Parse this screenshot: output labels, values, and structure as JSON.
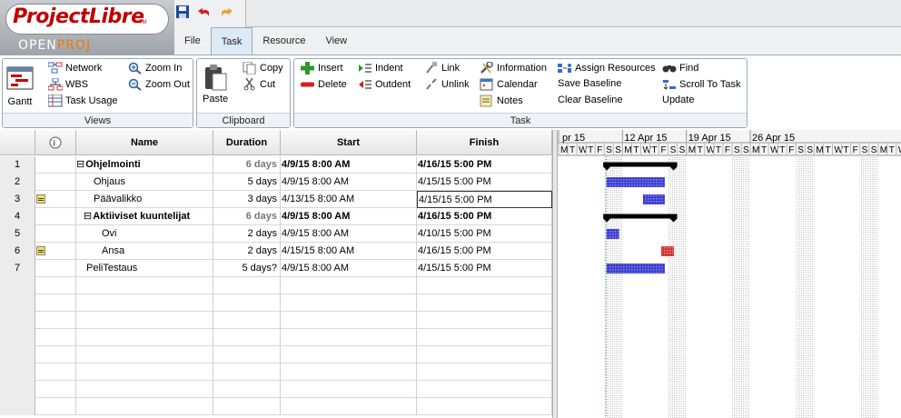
{
  "app": {
    "logo_main": "ProjectLibre",
    "logo_tm": "TM",
    "logo_sub_a": "OPEN",
    "logo_sub_b": "PROJ"
  },
  "quick_access": {
    "icons": [
      "save-icon",
      "undo-icon",
      "redo-icon"
    ]
  },
  "tabs": [
    {
      "label": "File",
      "active": false
    },
    {
      "label": "Task",
      "active": true
    },
    {
      "label": "Resource",
      "active": false
    },
    {
      "label": "View",
      "active": false
    }
  ],
  "ribbon": {
    "views": {
      "label": "Views",
      "gantt": "Gantt",
      "network": "Network",
      "wbs": "WBS",
      "task_usage": "Task Usage",
      "zoom_in": "Zoom In",
      "zoom_out": "Zoom Out"
    },
    "clipboard": {
      "label": "Clipboard",
      "paste": "Paste",
      "copy": "Copy",
      "cut": "Cut"
    },
    "task": {
      "label": "Task",
      "insert": "Insert",
      "delete": "Delete",
      "indent": "Indent",
      "outdent": "Outdent",
      "link": "Link",
      "unlink": "Unlink",
      "information": "Information",
      "calendar": "Calendar",
      "notes": "Notes",
      "assign_resources": "Assign Resources",
      "save_baseline": "Save Baseline",
      "clear_baseline": "Clear Baseline",
      "find": "Find",
      "scroll_to_task": "Scroll To Task",
      "update": "Update"
    }
  },
  "table": {
    "headers": {
      "name": "Name",
      "duration": "Duration",
      "start": "Start",
      "finish": "Finish"
    },
    "rows": [
      {
        "id": "1",
        "name": "Ohjelmointi",
        "duration": "6 days",
        "start": "4/9/15 8:00 AM",
        "finish": "4/16/15 5:00 PM",
        "summary": true,
        "note": false
      },
      {
        "id": "2",
        "name": "Ohjaus",
        "duration": "5 days",
        "start": "4/9/15 8:00 AM",
        "finish": "4/15/15 5:00 PM",
        "summary": false,
        "note": false
      },
      {
        "id": "3",
        "name": "Päävalikko",
        "duration": "3 days",
        "start": "4/13/15 8:00 AM",
        "finish": "4/15/15 5:00 PM",
        "summary": false,
        "note": true
      },
      {
        "id": "4",
        "name": "Aktiiviset kuuntelijat",
        "duration": "6 days",
        "start": "4/9/15 8:00 AM",
        "finish": "4/16/15 5:00 PM",
        "summary": true,
        "note": false
      },
      {
        "id": "5",
        "name": "Ovi",
        "duration": "2 days",
        "start": "4/9/15 8:00 AM",
        "finish": "4/10/15 5:00 PM",
        "summary": false,
        "note": false
      },
      {
        "id": "6",
        "name": "Ansa",
        "duration": "2 days",
        "start": "4/15/15 8:00 AM",
        "finish": "4/16/15 5:00 PM",
        "summary": false,
        "note": true
      },
      {
        "id": "7",
        "name": "PeliTestaus",
        "duration": "5 days?",
        "start": "4/9/15 8:00 AM",
        "finish": "4/15/15 5:00 PM",
        "summary": false,
        "note": false
      }
    ]
  },
  "gantt": {
    "week_labels": [
      "pr 15",
      "12 Apr 15",
      "19 Apr 15",
      "26 Apr 15"
    ],
    "day_letters": [
      "M",
      "T",
      "W",
      "T",
      "F",
      "S",
      "S",
      "M",
      "T",
      "W",
      "T",
      "F",
      "S",
      "S",
      "M",
      "T",
      "W",
      "T",
      "F",
      "S",
      "S",
      "M",
      "T",
      "W",
      "T",
      "F",
      "S",
      "S",
      "M",
      "T",
      "W",
      "T",
      "F",
      "S",
      "S",
      "M",
      "T",
      "W",
      "T"
    ],
    "colors": {
      "task": "#3a3ad0",
      "critical": "#d03030",
      "summary": "#000000"
    }
  }
}
